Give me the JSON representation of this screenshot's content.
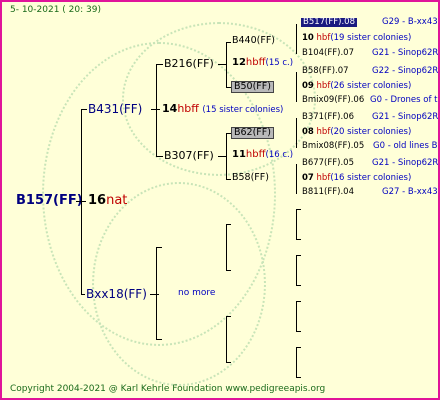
{
  "header_date": "5- 10-2021 ( 20: 39)",
  "copyright": "Copyright 2004-2021 @ Karl Kehrle Foundation   www.pedigreeapis.org",
  "subject": {
    "name": "B157(FF)",
    "count": "16",
    "count_label": "nat"
  },
  "parents": {
    "father": {
      "name": "B431(FF)",
      "count": "14",
      "count_label": "hbff",
      "note": "(15 sister colonies)"
    },
    "mother": {
      "name": "Bxx18(FF)",
      "note": "no more"
    }
  },
  "grandparents": [
    {
      "name": "B216(FF)",
      "count": "12",
      "count_label": "hbff",
      "note": "(15 c.)"
    },
    {
      "name": "B307(FF)",
      "count": "11",
      "count_label": "hbff",
      "note": "(16 c.)"
    }
  ],
  "gen4": [
    {
      "name": "B440(FF)"
    },
    {
      "name": "B50(FF)"
    },
    {
      "name": "B62(FF)"
    },
    {
      "name": "B58(FF)"
    }
  ],
  "gen5": [
    {
      "name": "B517(FF).08",
      "tag": "G29 - B-xx43",
      "count": "10",
      "count_label": "hbf",
      "note": "(19 sister colonies)"
    },
    {
      "name": "B104(FF).07",
      "tag": "G21 - Sinop62R"
    },
    {
      "name": "B58(FF).07",
      "tag": "G22 - Sinop62R",
      "count": "09",
      "count_label": "hbf",
      "note": "(26 sister colonies)"
    },
    {
      "name": "Bmix09(FF).06",
      "tag": "G0 - Drones of t"
    },
    {
      "name": "B371(FF).06",
      "tag": "G21 - Sinop62R",
      "count": "08",
      "count_label": "hbf",
      "note": "(20 sister colonies)"
    },
    {
      "name": "Bmix08(FF).05",
      "tag": "G0 - old lines B"
    },
    {
      "name": "B677(FF).05",
      "tag": "G21 - Sinop62R",
      "count": "07",
      "count_label": "hbf",
      "note": "(16 sister colonies)"
    },
    {
      "name": "B811(FF).04",
      "tag": "G27 - B-xx43"
    }
  ]
}
